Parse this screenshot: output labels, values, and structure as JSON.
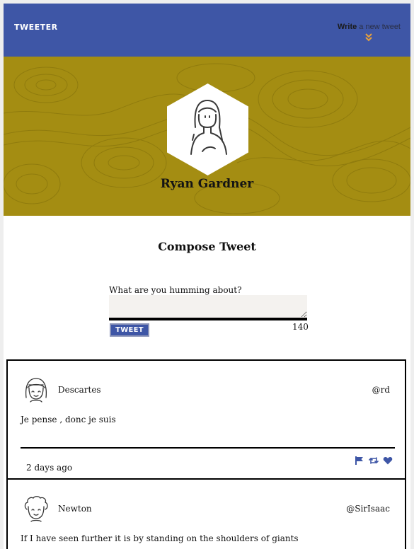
{
  "nav": {
    "brand": "TWEETER",
    "write_bold": "Write",
    "write_rest": " a new tweet"
  },
  "profile": {
    "name": "Ryan Gardner"
  },
  "compose": {
    "title": "Compose Tweet",
    "prompt": "What are you humming about?",
    "input_value": "",
    "button_label": "TWEET",
    "counter": "140"
  },
  "tweets": [
    {
      "name": "Descartes",
      "handle": "@rd",
      "content": "Je pense , donc je suis",
      "time": "2 days ago",
      "avatar_icon": "girl-avatar-icon"
    },
    {
      "name": "Newton",
      "handle": "@SirIsaac",
      "content": "If I have seen further it is by standing on the shoulders of giants",
      "avatar_icon": "curly-hair-avatar-icon"
    }
  ],
  "colors": {
    "nav": "#3e56a6",
    "hero": "#a48d12",
    "accent": "#e8a03a",
    "action": "#3e56a6"
  }
}
